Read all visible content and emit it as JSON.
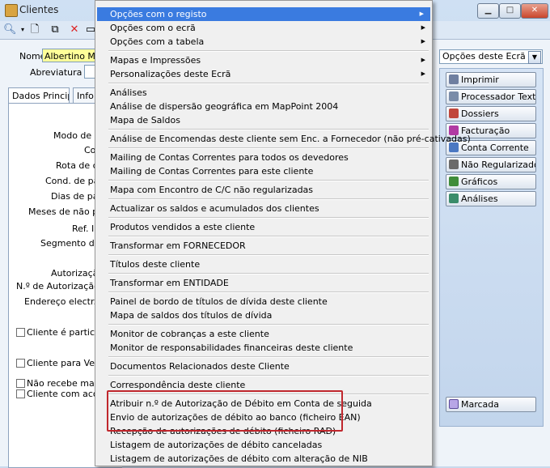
{
  "window": {
    "title": "Clientes",
    "controls": [
      "minimize",
      "maximize",
      "close"
    ]
  },
  "form": {
    "nome_label": "Nome",
    "nome_value": "Albertino Macie",
    "abreviatura_label": "Abreviatura",
    "tabs": [
      "Dados Principais",
      "Info"
    ],
    "labels": [
      "Modo de co",
      "Co",
      "Rota de co",
      "Cond. de paga",
      "Dias de paga",
      "Meses de não pag",
      "Ref. In",
      "Segmento de M",
      "Autorização",
      "N.º de Autorização de",
      "Endereço electr. p/ c"
    ],
    "checkboxes": [
      "Cliente é particular",
      "Cliente para Vendas",
      "Não recebe mailing c",
      "Cliente com acordo -"
    ]
  },
  "right_panel": {
    "dropdown_value": "Opções deste Ecrã",
    "buttons": [
      {
        "label": "Imprimir",
        "icon": "printer-icon",
        "color": "#6f7fa0"
      },
      {
        "label": "Processador Texto",
        "icon": "document-icon",
        "color": "#7a8ca9"
      },
      {
        "label": "Dossiers",
        "icon": "folder-icon",
        "color": "#c0463b"
      },
      {
        "label": "Facturação",
        "icon": "invoice-icon",
        "color": "#b13aa3"
      },
      {
        "label": "Conta Corrente",
        "icon": "account-icon",
        "color": "#4b78c2"
      },
      {
        "label": "Não Regularizado",
        "icon": "warning-icon",
        "color": "#6a6a6a"
      },
      {
        "label": "Gráficos",
        "icon": "chart-icon",
        "color": "#3f8c3a"
      },
      {
        "label": "Análises",
        "icon": "analysis-icon",
        "color": "#3a8c6a"
      }
    ],
    "marcada_label": "Marcada"
  },
  "menu": {
    "items": [
      {
        "label": "Opções com o registo",
        "submenu": true,
        "highlighted": true
      },
      {
        "label": "Opções com o ecrã",
        "submenu": true
      },
      {
        "label": "Opções com a tabela",
        "submenu": true
      },
      {
        "sep": true
      },
      {
        "label": "Mapas e Impressões",
        "submenu": true
      },
      {
        "label": "Personalizações deste Ecrã",
        "submenu": true
      },
      {
        "sep": true
      },
      {
        "label": "Análises"
      },
      {
        "label": "Análise de dispersão geográfica em MapPoint 2004"
      },
      {
        "label": "Mapa de Saldos"
      },
      {
        "sep": true
      },
      {
        "label": "Análise de Encomendas deste cliente sem Enc. a Fornecedor (não pré-cativadas)"
      },
      {
        "sep": true
      },
      {
        "label": "Mailing de Contas Correntes para todos os devedores"
      },
      {
        "label": "Mailing de Contas Correntes para este cliente"
      },
      {
        "sep": true
      },
      {
        "label": "Mapa com Encontro de C/C não regularizadas"
      },
      {
        "sep": true
      },
      {
        "label": "Actualizar os saldos e acumulados dos clientes"
      },
      {
        "sep": true
      },
      {
        "label": "Produtos vendidos a este cliente"
      },
      {
        "sep": true
      },
      {
        "label": "Transformar em FORNECEDOR"
      },
      {
        "sep": true
      },
      {
        "label": "Títulos deste cliente"
      },
      {
        "sep": true
      },
      {
        "label": "Transformar em ENTIDADE"
      },
      {
        "sep": true
      },
      {
        "label": "Painel de bordo de títulos de dívida deste cliente"
      },
      {
        "label": "Mapa de saldos dos títulos de dívida"
      },
      {
        "sep": true
      },
      {
        "label": "Monitor de cobranças a este cliente"
      },
      {
        "label": "Monitor de responsabilidades financeiras deste cliente"
      },
      {
        "sep": true
      },
      {
        "label": "Documentos Relacionados deste Cliente"
      },
      {
        "sep": true
      },
      {
        "label": "Correspondência deste cliente"
      },
      {
        "sep": true
      },
      {
        "label": "Atribuir n.º de Autorização de Débito em Conta de seguida"
      },
      {
        "label": "Envio de autorizações de débito ao banco (ficheiro EAN)"
      },
      {
        "label": "Recepção de autorizações de débito (ficheiro RAD)"
      },
      {
        "label": "Listagem de autorizações de débito canceladas"
      },
      {
        "label": "Listagem de autorizações de débito com alteração de NIB"
      }
    ],
    "highlight_color": "#3a7be0",
    "annotation_color": "#c0272d"
  }
}
